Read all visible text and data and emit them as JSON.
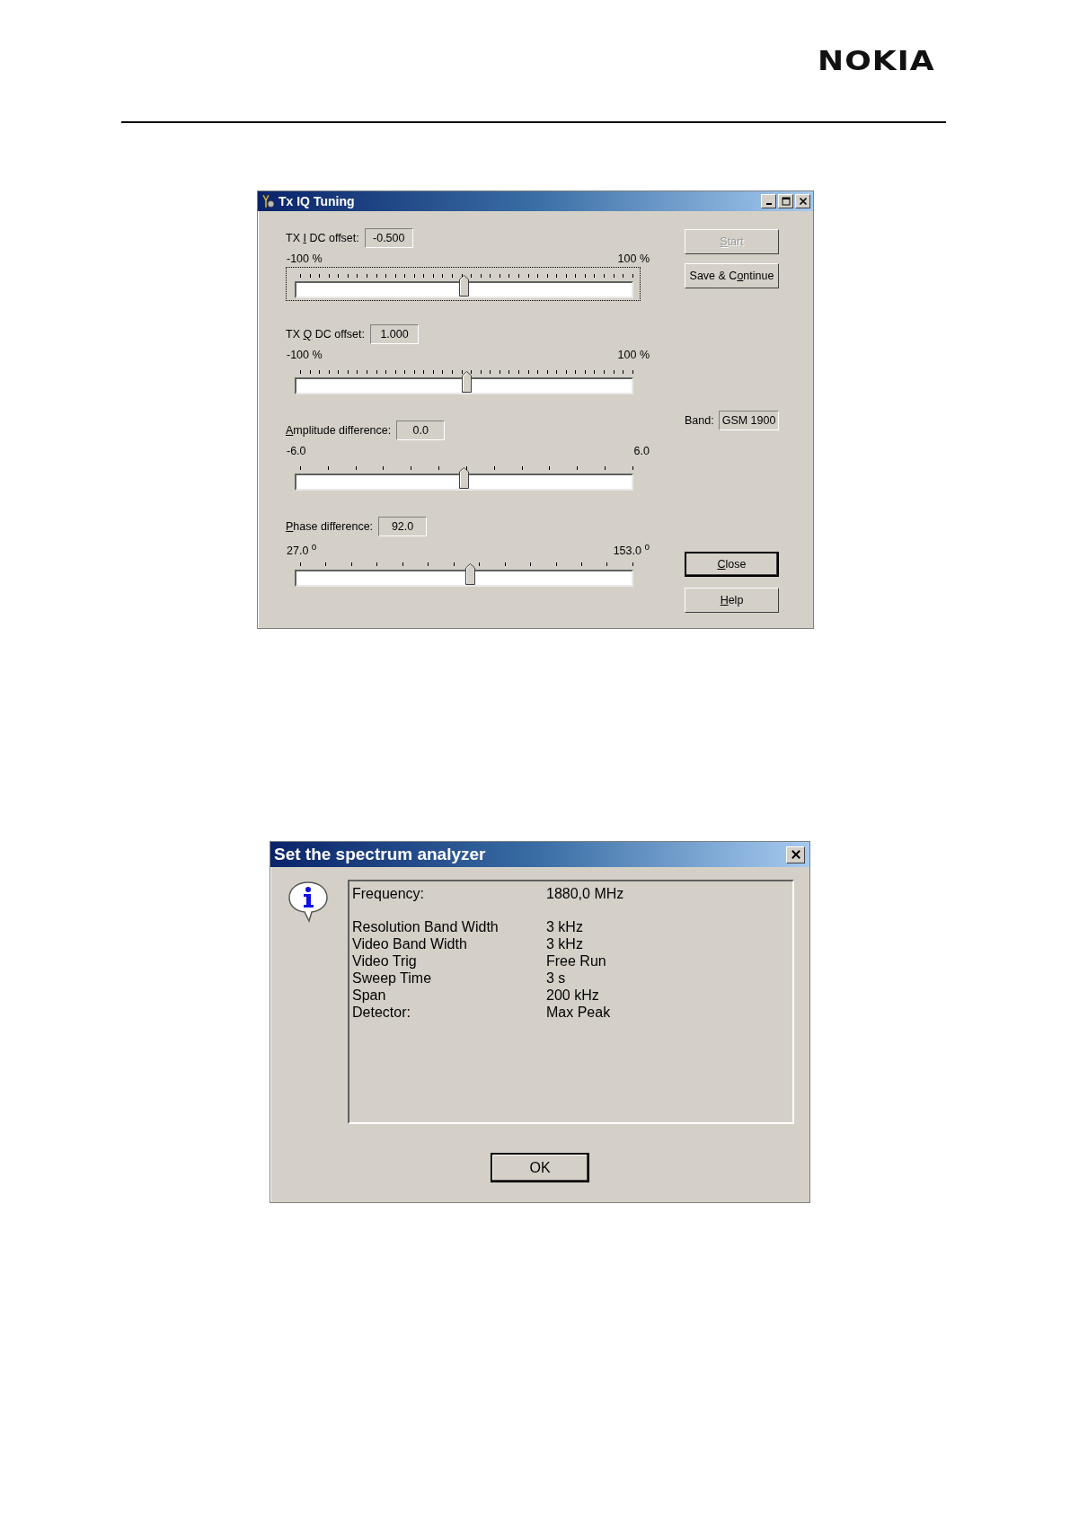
{
  "header": {
    "logo": "NOKIA"
  },
  "tuning_window": {
    "title": "Tx IQ Tuning",
    "sliders": [
      {
        "label": {
          "before": "TX ",
          "key": "I",
          "after": " DC offset:"
        },
        "value": "-0.500",
        "min_label": "-100 %",
        "max_label": "100 %",
        "level": 0.5,
        "focused": true
      },
      {
        "label": {
          "before": "TX ",
          "key": "Q",
          "after": " DC offset:"
        },
        "value": "1.000",
        "min_label": "-100 %",
        "max_label": "100 %",
        "level": 0.51,
        "focused": false
      },
      {
        "label": {
          "key": "A",
          "after": "mplitude difference:"
        },
        "value": "0.0",
        "min_label": "-6.0",
        "max_label": "6.0",
        "level": 0.5,
        "focused": false
      },
      {
        "label": {
          "key": "P",
          "after": "hase difference:"
        },
        "value": "92.0",
        "min_label": "27.0 $^{o}$",
        "max_label": "153.0 $^{o}$",
        "level": 0.52,
        "focused": false
      }
    ],
    "top_buttons": [
      {
        "label": {
          "key": "S",
          "after": "tart"
        },
        "disabled": true,
        "default": false
      },
      {
        "label": {
          "before": "Save & C",
          "key": "o",
          "after": "ntinue"
        },
        "disabled": false,
        "default": false
      }
    ],
    "band": {
      "label": "Band:",
      "value": "GSM 1900"
    },
    "bottom_buttons": [
      {
        "label": {
          "key": "C",
          "after": "lose"
        },
        "disabled": false,
        "default": true
      },
      {
        "label": {
          "key": "H",
          "after": "elp"
        },
        "disabled": false,
        "default": false
      }
    ]
  },
  "analyzer_dialog": {
    "title": "Set the spectrum analyzer",
    "groups": [
      [
        {
          "label": "Frequency:",
          "value": "1880,0 MHz"
        }
      ],
      [
        {
          "label": "Resolution Band Width",
          "value": "3 kHz"
        },
        {
          "label": "Video Band Width",
          "value": "3 kHz"
        },
        {
          "label": "Video Trig",
          "value": "Free Run"
        },
        {
          "label": "Sweep Time",
          "value": "3 s"
        },
        {
          "label": "Span",
          "value": "200 kHz"
        },
        {
          "label": "Detector:",
          "value": "Max Peak"
        }
      ]
    ],
    "ok_button": "OK"
  }
}
